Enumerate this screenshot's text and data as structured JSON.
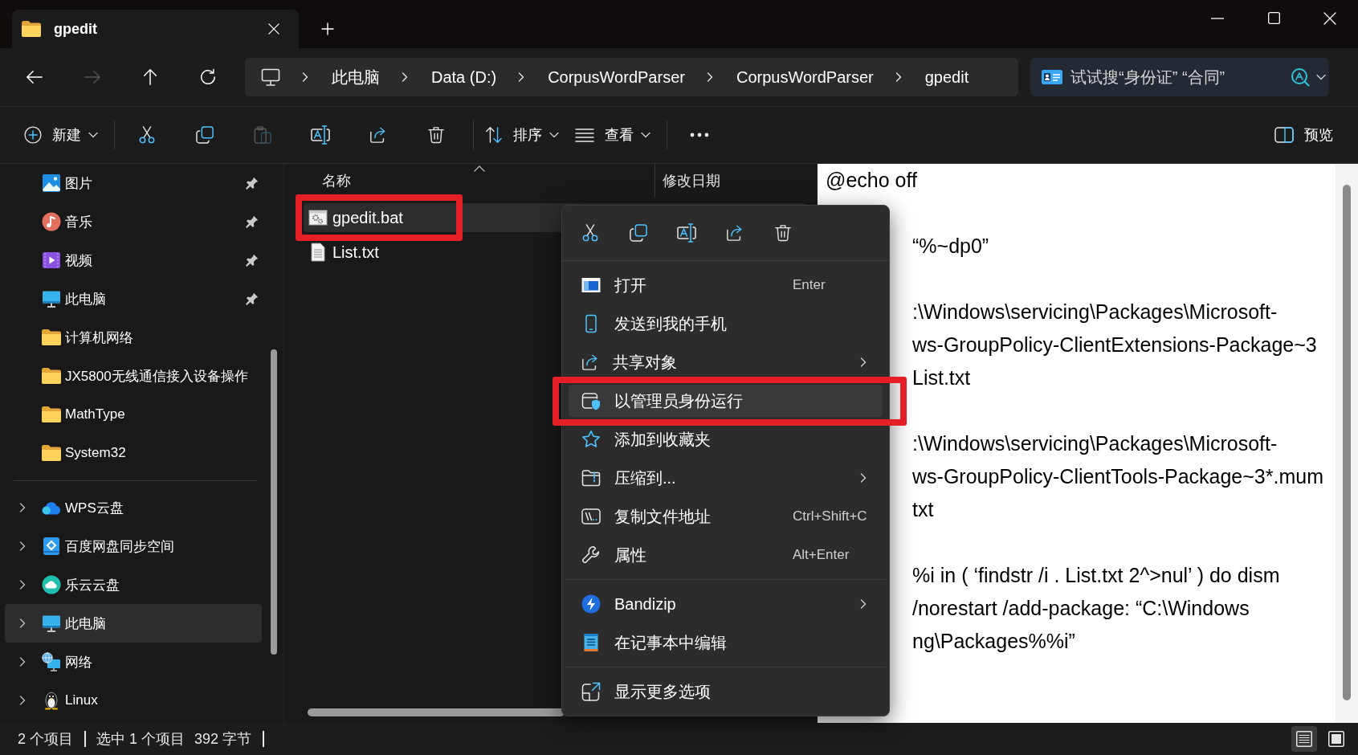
{
  "tabs": [
    {
      "title": "gpedit",
      "selected": true
    }
  ],
  "nav_buttons": [
    {
      "kind": "back",
      "disabled": false
    },
    {
      "kind": "forward",
      "disabled": true
    },
    {
      "kind": "up",
      "disabled": false
    },
    {
      "kind": "refresh",
      "disabled": false
    }
  ],
  "address_bar": {
    "crumbs": [
      "此电脑",
      "Data (D:)",
      "CorpusWordParser",
      "CorpusWordParser",
      "gpedit"
    ]
  },
  "search": {
    "placeholder": "试试搜“身份证” “合同”"
  },
  "command_groups": [
    [
      {
        "kind": "new",
        "label": "新建",
        "dropdown": true
      }
    ],
    [
      {
        "kind": "cut",
        "disabled": false
      },
      {
        "kind": "copy",
        "disabled": false
      },
      {
        "kind": "paste",
        "disabled": true
      },
      {
        "kind": "rename",
        "disabled": false
      },
      {
        "kind": "share",
        "disabled": false
      },
      {
        "kind": "delete",
        "disabled": false
      }
    ],
    [
      {
        "kind": "sort",
        "label": "排序",
        "dropdown": true
      },
      {
        "kind": "view",
        "label": "查看",
        "dropdown": true
      }
    ],
    [
      {
        "kind": "more",
        "disabled": false
      }
    ]
  ],
  "preview_toggle": {
    "label": "预览"
  },
  "sidebar": {
    "quick_access": [
      {
        "label": "图片",
        "kind": "pictures",
        "pinned": true,
        "selected": false
      },
      {
        "label": "音乐",
        "kind": "music",
        "pinned": true,
        "selected": false
      },
      {
        "label": "视频",
        "kind": "videos",
        "pinned": true,
        "selected": false
      },
      {
        "label": "此电脑",
        "kind": "pc",
        "pinned": true,
        "selected": false
      },
      {
        "label": "计算机网络",
        "kind": "folder",
        "pinned": false,
        "selected": false
      },
      {
        "label": "JX5800无线通信接入设备操作",
        "kind": "folder",
        "pinned": false,
        "selected": false
      },
      {
        "label": "MathType",
        "kind": "folder",
        "pinned": false,
        "selected": false
      },
      {
        "label": "System32",
        "kind": "folder",
        "pinned": false,
        "selected": false
      }
    ],
    "locations": [
      {
        "label": "WPS云盘",
        "kind": "wps",
        "expanded": false,
        "selected": false
      },
      {
        "label": "百度网盘同步空间",
        "kind": "baidu",
        "expanded": false,
        "selected": false
      },
      {
        "label": "乐云云盘",
        "kind": "leyun",
        "expanded": false,
        "selected": false
      },
      {
        "label": "此电脑",
        "kind": "pc",
        "expanded": false,
        "selected": true
      },
      {
        "label": "网络",
        "kind": "network",
        "expanded": false,
        "selected": false
      },
      {
        "label": "Linux",
        "kind": "linux",
        "expanded": false,
        "selected": false
      }
    ]
  },
  "file_list": {
    "columns": [
      {
        "label": "名称",
        "sorted": true
      },
      {
        "label": "修改日期",
        "sorted": false
      }
    ],
    "files": [
      {
        "name": "gpedit.bat",
        "kind": "batch",
        "selected": true,
        "framed": true
      },
      {
        "name": "List.txt",
        "kind": "text",
        "selected": false,
        "framed": false
      }
    ]
  },
  "preview": {
    "paragraphs": [
      [
        "@echo off"
      ],
      [
        "“%~dp0”"
      ],
      [
        ":\\Windows\\servicing\\Packages\\Microsoft-",
        "ws-GroupPolicy-ClientExtensions-Package~3",
        "List.txt"
      ],
      [
        ":\\Windows\\servicing\\Packages\\Microsoft-",
        "ws-GroupPolicy-ClientTools-Package~3*.mum",
        "txt"
      ],
      [
        "%i in ( ‘findstr /i . List.txt 2^>nul’ ) do dism",
        "/norestart /add-package: “C:\\Windows",
        "ng\\Packages%%i”"
      ]
    ]
  },
  "context_menu": {
    "quick_actions": [
      {
        "kind": "cut"
      },
      {
        "kind": "copy"
      },
      {
        "kind": "rename"
      },
      {
        "kind": "share"
      },
      {
        "kind": "delete"
      }
    ],
    "groups": [
      [
        {
          "kind": "open",
          "label": "打开",
          "shortcut": "Enter",
          "submenu": false,
          "selected": false,
          "framed": false
        },
        {
          "kind": "phone",
          "label": "发送到我的手机",
          "submenu": false,
          "selected": false,
          "framed": false
        },
        {
          "kind": "share",
          "label": "共享对象",
          "submenu": true,
          "selected": false,
          "framed": false
        },
        {
          "kind": "admin",
          "label": "以管理员身份运行",
          "submenu": false,
          "selected": true,
          "framed": true
        },
        {
          "kind": "star",
          "label": "添加到收藏夹",
          "submenu": false,
          "selected": false,
          "framed": false
        },
        {
          "kind": "zip",
          "label": "压缩到...",
          "submenu": true,
          "selected": false,
          "framed": false
        },
        {
          "kind": "path",
          "label": "复制文件地址",
          "shortcut": "Ctrl+Shift+C",
          "submenu": false,
          "selected": false,
          "framed": false
        },
        {
          "kind": "properties",
          "label": "属性",
          "shortcut": "Alt+Enter",
          "submenu": false,
          "selected": false,
          "framed": false
        }
      ],
      [
        {
          "kind": "bandizip",
          "label": "Bandizip",
          "submenu": true,
          "selected": false,
          "framed": false
        },
        {
          "kind": "notepad",
          "label": "在记事本中编辑",
          "submenu": false,
          "selected": false,
          "framed": false
        }
      ],
      [
        {
          "kind": "more_options",
          "label": "显示更多选项",
          "submenu": false,
          "selected": false,
          "framed": false
        }
      ]
    ]
  },
  "status_bar": {
    "item_count": "2 个项目",
    "selection": "选中 1 个项目",
    "selection_size": "392 字节",
    "views": [
      {
        "kind": "details",
        "selected": true
      },
      {
        "kind": "tiles",
        "selected": false
      }
    ]
  }
}
